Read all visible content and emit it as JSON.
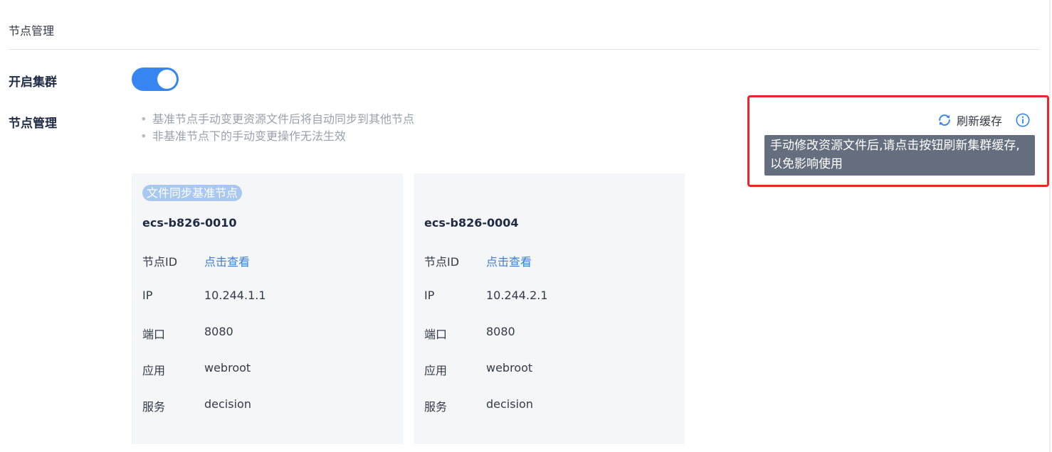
{
  "header": {
    "title": "节点管理"
  },
  "cluster": {
    "label": "开启集群",
    "enabled": true
  },
  "node_management": {
    "label": "节点管理",
    "notes": [
      "基准节点手动变更资源文件后将自动同步到其他节点",
      "非基准节点下的手动变更操作无法生效"
    ],
    "refresh_label": "刷新缓存",
    "tooltip": "手动修改资源文件后,请点击按钮刷新集群缓存,以免影响使用",
    "highlight_color": "#e8272a"
  },
  "nodes": [
    {
      "badge": "文件同步基准节点",
      "host": "ecs-b826-0010",
      "fields": [
        {
          "label": "节点ID",
          "value": "点击查看"
        },
        {
          "label": "IP",
          "value": "10.244.1.1"
        },
        {
          "label": "端口",
          "value": "8080"
        },
        {
          "label": "应用",
          "value": "webroot"
        },
        {
          "label": "服务",
          "value": "decision"
        }
      ]
    },
    {
      "host": "ecs-b826-0004",
      "fields": [
        {
          "label": "节点ID",
          "value": "点击查看"
        },
        {
          "label": "IP",
          "value": "10.244.2.1"
        },
        {
          "label": "端口",
          "value": "8080"
        },
        {
          "label": "应用",
          "value": "webroot"
        },
        {
          "label": "服务",
          "value": "decision"
        }
      ]
    }
  ],
  "icons": {
    "refresh": "refresh-icon",
    "info": "info-icon"
  },
  "colors": {
    "accent": "#3685f2",
    "link": "#3e7fd3",
    "tooltip_bg": "#656e7f",
    "card_bg": "#f5f6f8"
  }
}
